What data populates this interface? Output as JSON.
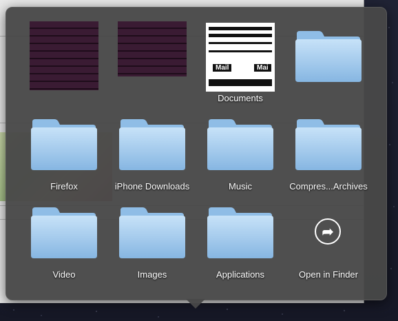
{
  "stack": {
    "items": [
      {
        "label": "",
        "kind": "dark-preview-icon"
      },
      {
        "label": "",
        "kind": "dark-preview-icon"
      },
      {
        "label": "Documents",
        "kind": "document-preview-icon",
        "preview_text": [
          "Mail",
          "Mai"
        ]
      },
      {
        "label": "",
        "kind": "folder-icon"
      },
      {
        "label": "Firefox",
        "kind": "folder-icon"
      },
      {
        "label": "iPhone Downloads",
        "kind": "folder-icon"
      },
      {
        "label": "Music",
        "kind": "folder-icon"
      },
      {
        "label": "Compres...Archives",
        "kind": "folder-icon"
      },
      {
        "label": "Video",
        "kind": "folder-icon"
      },
      {
        "label": "Images",
        "kind": "folder-icon"
      },
      {
        "label": "Applications",
        "kind": "folder-icon"
      },
      {
        "label": "Open in Finder",
        "kind": "open-arrow-icon"
      }
    ]
  },
  "colors": {
    "folder_light": "#b9d9f4",
    "folder_dark": "#7fb2e0",
    "panel": "#484848"
  }
}
